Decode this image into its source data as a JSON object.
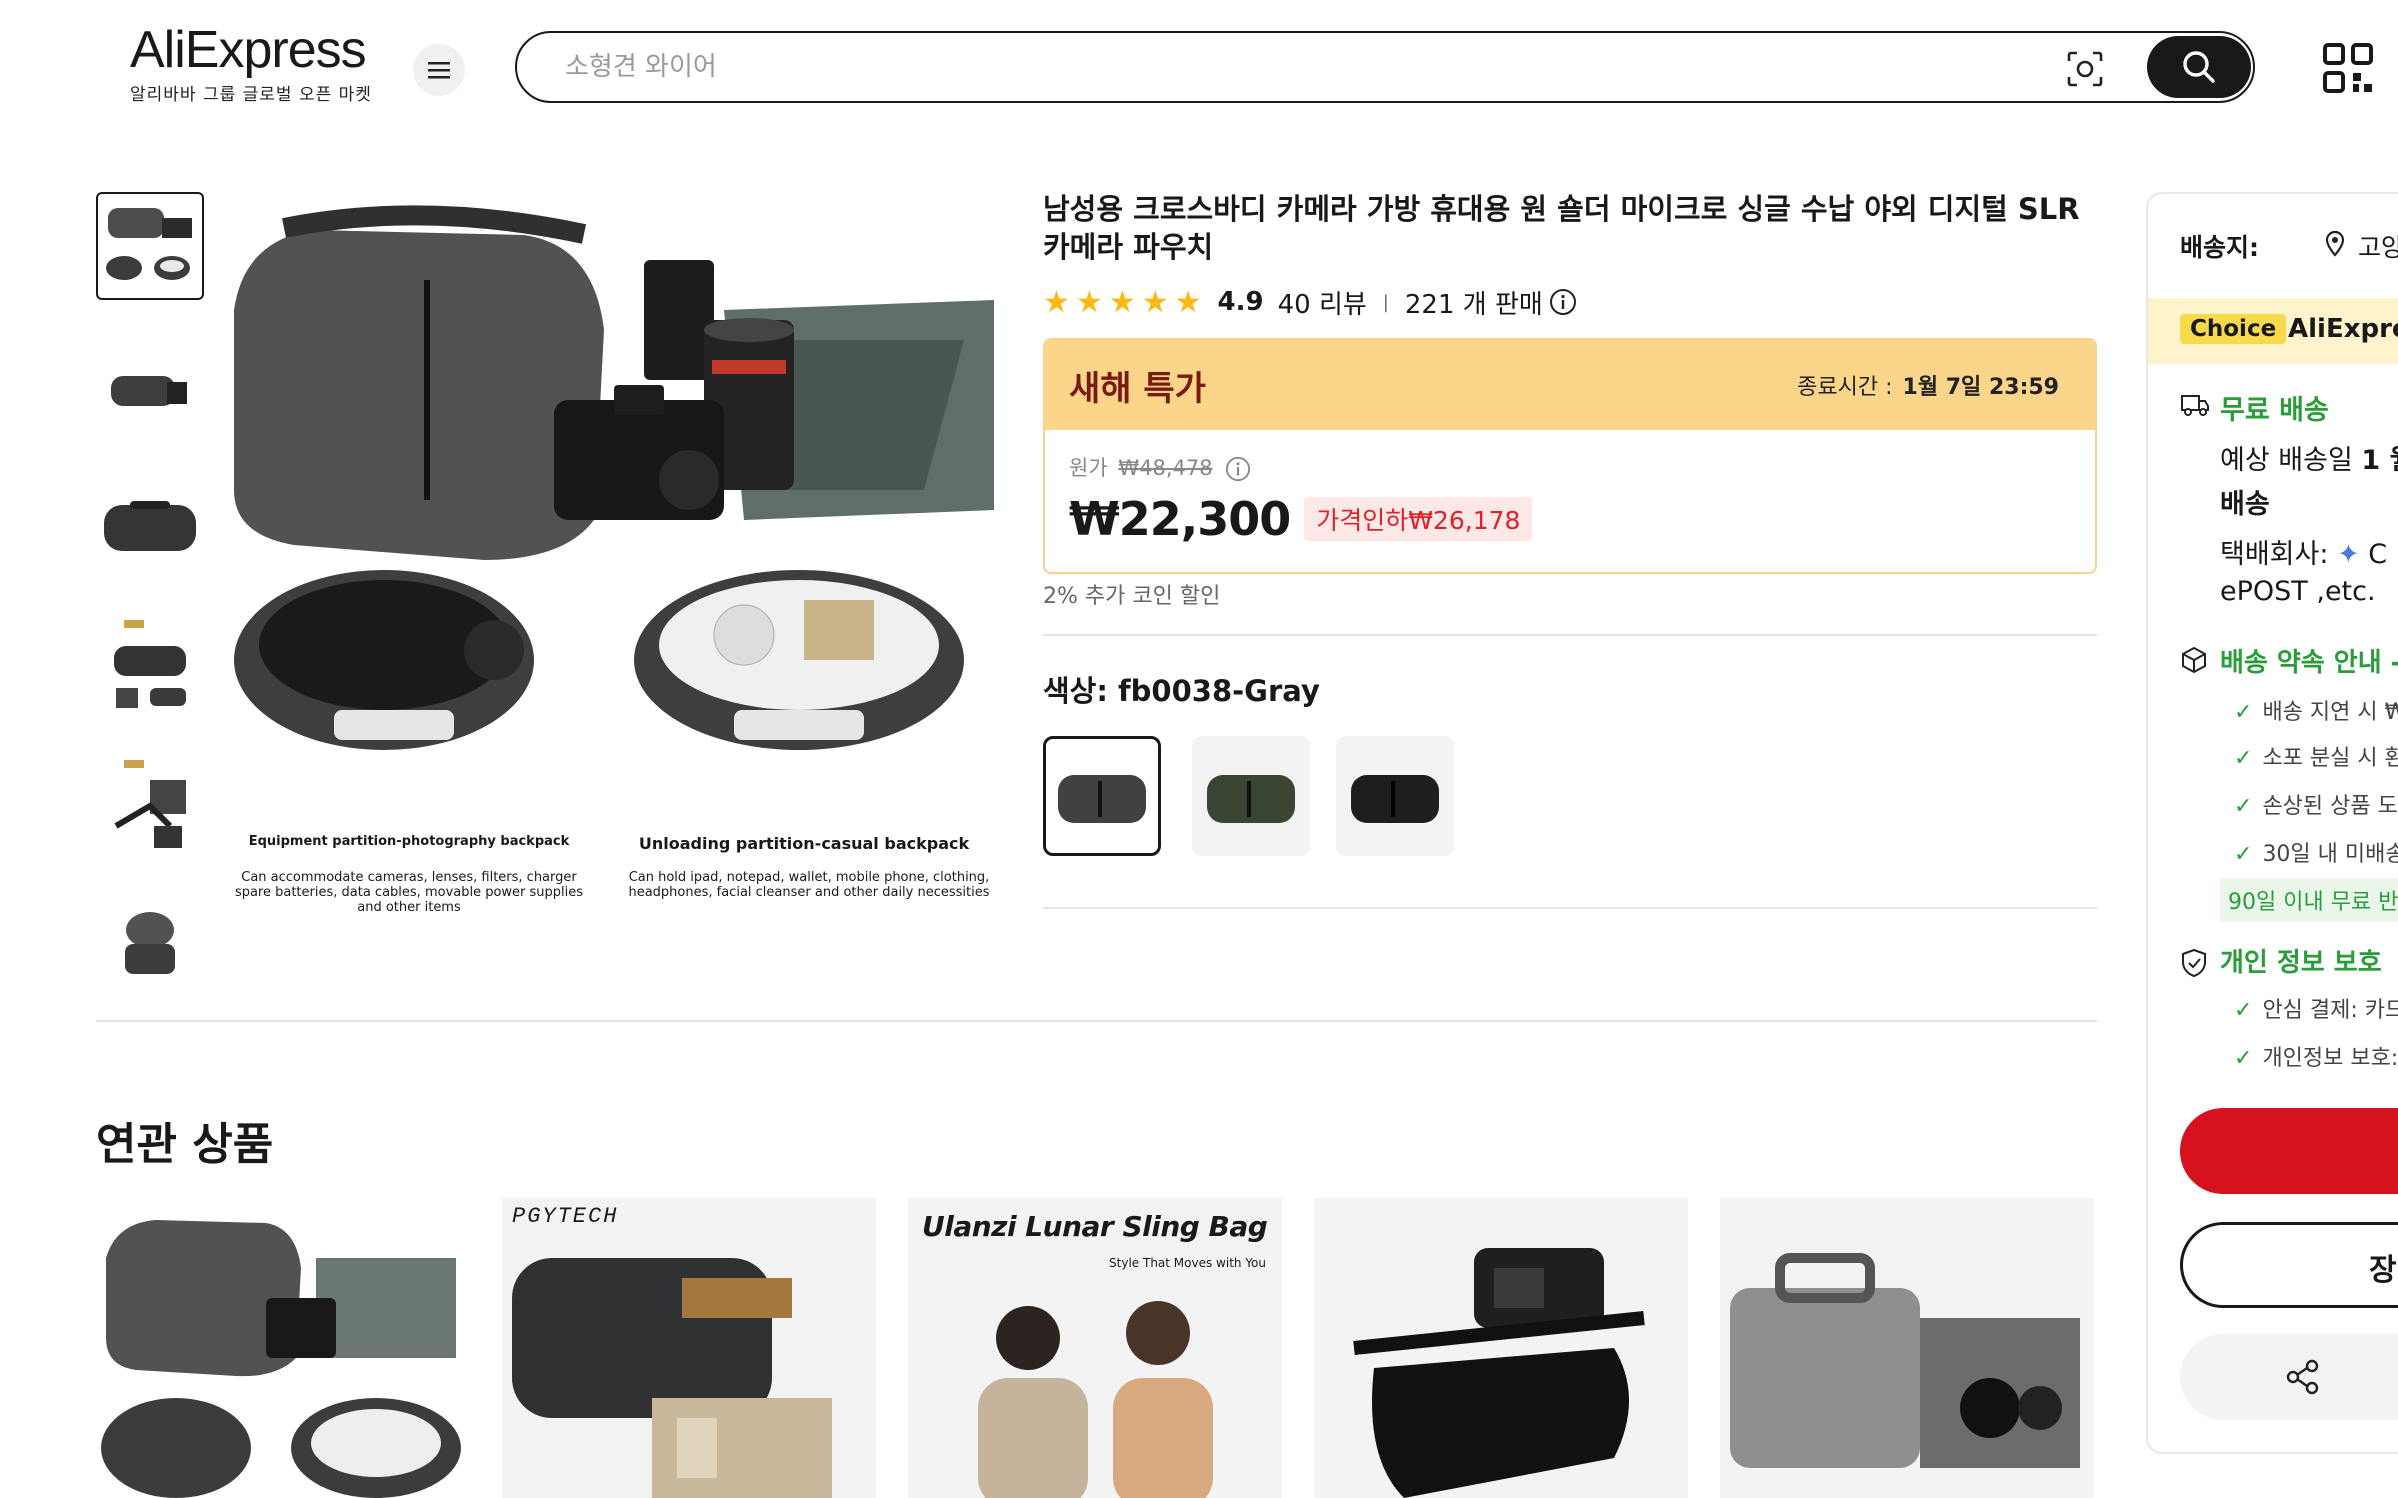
{
  "header": {
    "logo_text": "AliExpress",
    "logo_sub": "알리바바 그룹 글로벌 오픈 마켓",
    "search_placeholder": "소형견 와이어"
  },
  "product": {
    "title": "남성용 크로스바디 카메라 가방 휴대용 원 숄더 마이크로 싱글 수납 야외 디지털 SLR 카메라 파우치",
    "rating": "4.9",
    "reviews": "40 리뷰",
    "sold": "221 개 판매",
    "deal_label": "새해 특가",
    "end_label": "종료시간 :",
    "end_time": "1월 7일 23:59",
    "orig_label": "원가",
    "orig_price": "₩48,478",
    "price": "₩22,300",
    "price_drop": "가격인하₩26,178",
    "coin": "2% 추가 코인 할인",
    "color_label": "색상: fb0038-Gray"
  },
  "gallery": {
    "caption_left_title": "Equipment partition-photography backpack",
    "caption_left_body": "Can accommodate cameras, lenses, filters, charger spare batteries, data cables, movable power supplies and other items",
    "caption_right_title": "Unloading partition-casual backpack",
    "caption_right_body": "Can hold ipad, notepad, wallet, mobile phone, clothing, headphones, facial cleanser and other daily necessities"
  },
  "related": {
    "title": "연관 상품",
    "card2_brand": "PGYTECH",
    "card3_brand": "Ulanzi Lunar Sling Bag",
    "card3_tag": "Style That Moves with You"
  },
  "panel": {
    "ship_to": "배송지:",
    "ship_loc": "고양",
    "choice": "Choice",
    "choice_brand": "AliExpre",
    "free_ship": "무료 배송",
    "eta_a": "예상 배송일",
    "eta_b": "1 월",
    "eta_c": "배송",
    "courier_a": "택배회사:",
    "courier_b": "C",
    "courier_c": "ePOST ,etc.",
    "promise": "배송 약속 안내 -",
    "p1": "배송 지연 시 ₩",
    "p2": "소포 분실 시 환",
    "p3": "손상된 상품 도",
    "p4": "30일 내 미배송",
    "return": "90일 이내 무료 반",
    "privacy": "개인 정보 보호",
    "s1": "안심 결제: 카드",
    "s2": "개인정보 보호:",
    "cart_btn": "장"
  },
  "colors": {
    "accent_red": "#d7121f",
    "green": "#2a9d3a",
    "deal_bg": "#fbd589"
  }
}
